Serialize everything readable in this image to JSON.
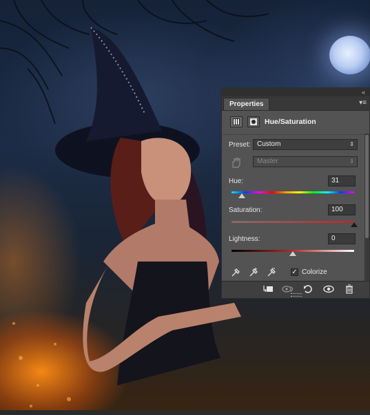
{
  "panel": {
    "tab_label": "Properties",
    "collapse_icon": "«",
    "menu_icon": "▾≡",
    "adjustment_title": "Hue/Saturation",
    "preset_label": "Preset:",
    "preset_value": "Custom",
    "channel_value": "Master",
    "hue_label": "Hue:",
    "hue_value": "31",
    "saturation_label": "Saturation:",
    "saturation_value": "100",
    "lightness_label": "Lightness:",
    "lightness_value": "0",
    "colorize_label": "Colorize",
    "colorize_checked": "✓"
  },
  "sliders": {
    "hue": 31,
    "saturation": 100,
    "lightness": 0
  },
  "colors": {
    "panel_bg": "#535353",
    "footer_bg": "#3f3f3f",
    "saturation_track": "#b32b2b"
  },
  "icons": [
    "adjustment-layer-icon",
    "mask-icon",
    "targeted-adjust-hand-icon",
    "eyedropper-icon",
    "eyedropper-plus-icon",
    "eyedropper-minus-icon",
    "clip-to-layer-icon",
    "view-previous-state-icon",
    "reset-icon",
    "visibility-eye-icon",
    "trash-icon"
  ]
}
